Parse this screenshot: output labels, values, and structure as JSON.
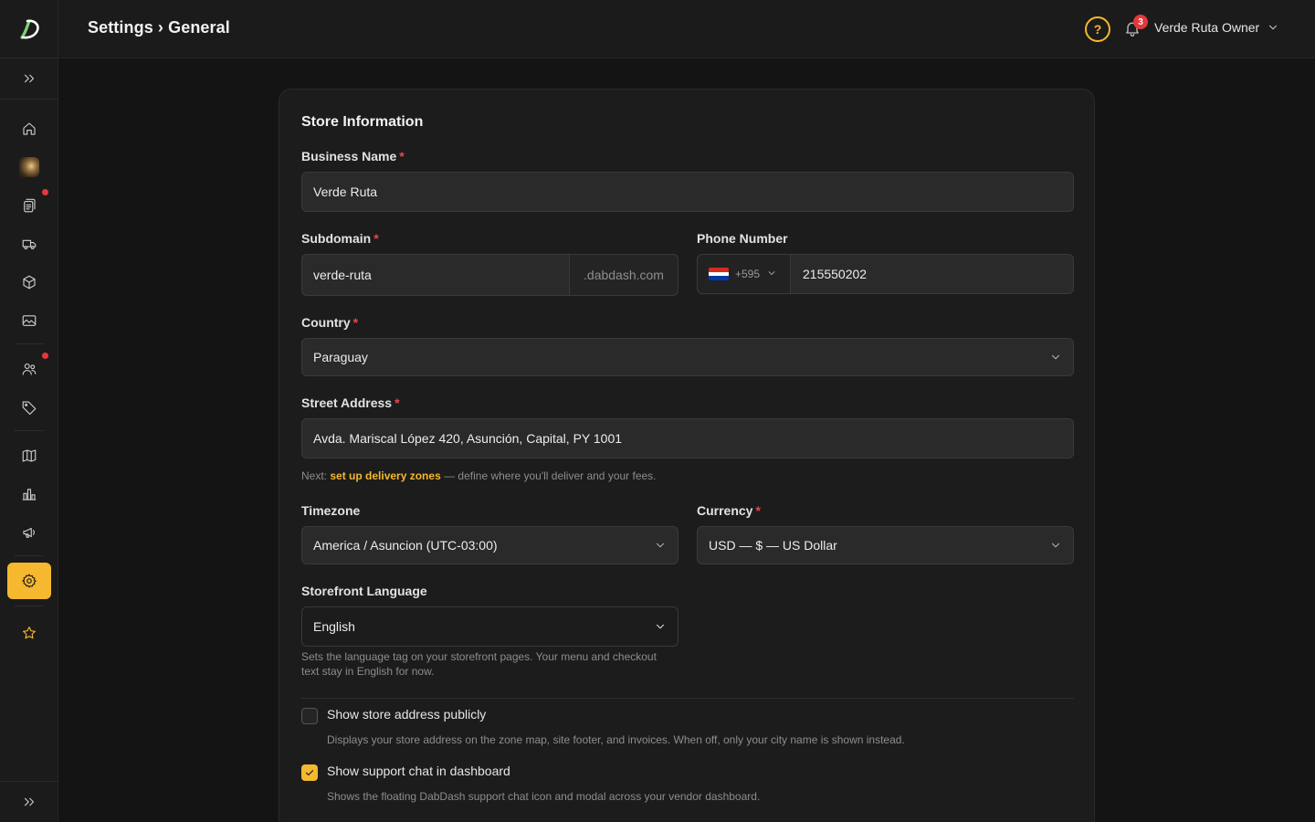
{
  "header": {
    "title": "Settings › General",
    "help_icon": "?",
    "notification_count": "3",
    "user_name": "Verde Ruta Owner"
  },
  "sidebar": {
    "items": [
      {
        "name": "home-icon"
      },
      {
        "name": "store-avatar"
      },
      {
        "name": "orders-icon",
        "dot": true
      },
      {
        "name": "delivery-truck-icon"
      },
      {
        "name": "products-box-icon"
      },
      {
        "name": "media-image-icon"
      },
      {
        "name": "customers-icon",
        "dot": true
      },
      {
        "name": "tag-icon"
      },
      {
        "name": "map-icon"
      },
      {
        "name": "analytics-icon"
      },
      {
        "name": "marketing-megaphone-icon"
      },
      {
        "name": "settings-gear-icon",
        "active": true
      },
      {
        "name": "star-icon"
      }
    ]
  },
  "form": {
    "section_title": "Store Information",
    "business_name": {
      "label": "Business Name",
      "value": "Verde Ruta"
    },
    "subdomain": {
      "label": "Subdomain",
      "value": "verde-ruta",
      "suffix": ".dabdash.com"
    },
    "phone": {
      "label": "Phone Number",
      "code": "+595",
      "value": "215550202"
    },
    "country": {
      "label": "Country",
      "value": "Paraguay"
    },
    "street_address": {
      "label": "Street Address",
      "value": "Avda. Mariscal López 420, Asunción, Capital, PY 1001"
    },
    "address_hint": {
      "prefix": "Next:",
      "link": "set up delivery zones",
      "suffix": "— define where you'll deliver and your fees."
    },
    "timezone": {
      "label": "Timezone",
      "value": "America / Asuncion (UTC-03:00)"
    },
    "currency": {
      "label": "Currency",
      "value": "USD — $ — US Dollar"
    },
    "language": {
      "label": "Storefront Language",
      "value": "English",
      "hint_line1": "Sets the language tag on your storefront pages. Your menu and checkout",
      "hint_line2": "text stay in English for now."
    },
    "show_address": {
      "label": "Show store address publicly",
      "checked": false,
      "description": "Displays your store address on the zone map, site footer, and invoices. When off, only your city name is shown instead."
    },
    "show_support": {
      "label": "Show support chat in dashboard",
      "checked": true,
      "description": "Shows the floating DabDash support chat icon and modal across your vendor dashboard."
    }
  },
  "colors": {
    "accent": "#f5b82e",
    "required": "#e5484d",
    "badge": "#e5383b",
    "background": "#141414",
    "card": "#1c1c1c"
  }
}
